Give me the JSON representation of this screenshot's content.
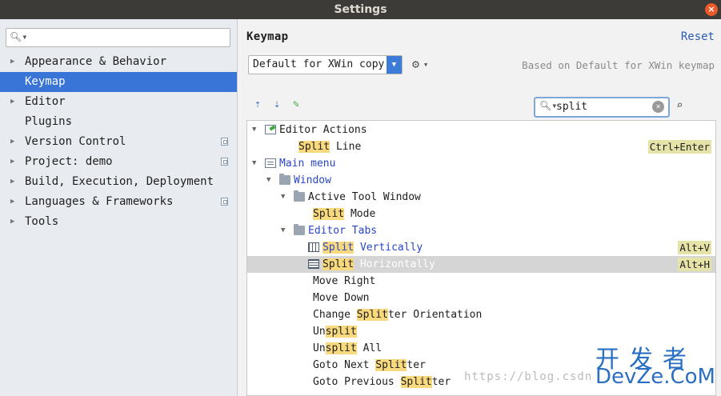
{
  "window": {
    "title": "Settings",
    "close_glyph": "×"
  },
  "sidebar": {
    "search_value": "",
    "items": [
      {
        "label": "Appearance & Behavior",
        "expandable": true,
        "selected": false,
        "project_level": false
      },
      {
        "label": "Keymap",
        "expandable": false,
        "selected": true,
        "project_level": false
      },
      {
        "label": "Editor",
        "expandable": true,
        "selected": false,
        "project_level": false
      },
      {
        "label": "Plugins",
        "expandable": false,
        "selected": false,
        "project_level": false
      },
      {
        "label": "Version Control",
        "expandable": true,
        "selected": false,
        "project_level": true
      },
      {
        "label": "Project: demo",
        "expandable": true,
        "selected": false,
        "project_level": true
      },
      {
        "label": "Build, Execution, Deployment",
        "expandable": true,
        "selected": false,
        "project_level": false
      },
      {
        "label": "Languages & Frameworks",
        "expandable": true,
        "selected": false,
        "project_level": true
      },
      {
        "label": "Tools",
        "expandable": true,
        "selected": false,
        "project_level": false
      }
    ]
  },
  "keymap": {
    "title": "Keymap",
    "reset_label": "Reset",
    "scheme_value": "Default for XWin copy",
    "based_on": "Based on Default for XWin keymap",
    "filter_value": "split",
    "icons": {
      "expand_all": "expand-all-icon",
      "collapse_all": "collapse-all-icon",
      "edit": "pencil-icon",
      "gear": "gear-icon",
      "find_shortcut": "find-by-shortcut-icon"
    }
  },
  "tree": {
    "rows": [
      {
        "depth": 0,
        "twisty": "▼",
        "icon": "edit",
        "parts": [
          [
            "Editor Actions",
            ""
          ]
        ],
        "blue": false,
        "selected": false,
        "shortcut": ""
      },
      {
        "depth": 1,
        "twisty": "",
        "icon": "",
        "parts": [
          [
            "Split",
            "hl"
          ],
          [
            " Line",
            ""
          ]
        ],
        "blue": false,
        "selected": false,
        "shortcut": "Ctrl+Enter"
      },
      {
        "depth": 0,
        "twisty": "▼",
        "icon": "menu",
        "parts": [
          [
            "Main menu",
            ""
          ]
        ],
        "blue": true,
        "selected": false,
        "shortcut": ""
      },
      {
        "depth": 1,
        "twisty": "▼",
        "icon": "folder",
        "parts": [
          [
            "Window",
            ""
          ]
        ],
        "blue": true,
        "selected": false,
        "shortcut": ""
      },
      {
        "depth": 2,
        "twisty": "▼",
        "icon": "folder",
        "parts": [
          [
            "Active Tool Window",
            ""
          ]
        ],
        "blue": false,
        "selected": false,
        "shortcut": ""
      },
      {
        "depth": 3,
        "twisty": "",
        "icon": "",
        "parts": [
          [
            "Split",
            "hl"
          ],
          [
            " Mode",
            ""
          ]
        ],
        "blue": false,
        "selected": false,
        "shortcut": ""
      },
      {
        "depth": 2,
        "twisty": "▼",
        "icon": "folder",
        "parts": [
          [
            "Editor Tabs",
            ""
          ]
        ],
        "blue": true,
        "selected": false,
        "shortcut": ""
      },
      {
        "depth": 3,
        "twisty": "",
        "icon": "vsplit",
        "parts": [
          [
            "Split",
            "hl"
          ],
          [
            " Vertically",
            ""
          ]
        ],
        "blue": true,
        "selected": false,
        "shortcut": "Alt+V"
      },
      {
        "depth": 3,
        "twisty": "",
        "icon": "hsplit",
        "parts": [
          [
            "Split",
            "hl"
          ],
          [
            " Horizontally",
            ""
          ]
        ],
        "blue": false,
        "selected": true,
        "shortcut": "Alt+H"
      },
      {
        "depth": 3,
        "twisty": "",
        "icon": "",
        "parts": [
          [
            "Move Right",
            ""
          ]
        ],
        "blue": false,
        "selected": false,
        "shortcut": ""
      },
      {
        "depth": 3,
        "twisty": "",
        "icon": "",
        "parts": [
          [
            "Move Down",
            ""
          ]
        ],
        "blue": false,
        "selected": false,
        "shortcut": ""
      },
      {
        "depth": 3,
        "twisty": "",
        "icon": "",
        "parts": [
          [
            "Change ",
            ""
          ],
          [
            "Split",
            "hl"
          ],
          [
            "ter Orientation",
            ""
          ]
        ],
        "blue": false,
        "selected": false,
        "shortcut": ""
      },
      {
        "depth": 3,
        "twisty": "",
        "icon": "",
        "parts": [
          [
            "Un",
            ""
          ],
          [
            "split",
            "hl"
          ]
        ],
        "blue": false,
        "selected": false,
        "shortcut": ""
      },
      {
        "depth": 3,
        "twisty": "",
        "icon": "",
        "parts": [
          [
            "Un",
            ""
          ],
          [
            "split",
            "hl"
          ],
          [
            " All",
            ""
          ]
        ],
        "blue": false,
        "selected": false,
        "shortcut": ""
      },
      {
        "depth": 3,
        "twisty": "",
        "icon": "",
        "parts": [
          [
            "Goto Next ",
            ""
          ],
          [
            "Split",
            "hl"
          ],
          [
            "ter",
            ""
          ]
        ],
        "blue": false,
        "selected": false,
        "shortcut": ""
      },
      {
        "depth": 3,
        "twisty": "",
        "icon": "",
        "parts": [
          [
            "Goto Previous ",
            ""
          ],
          [
            "Split",
            "hl"
          ],
          [
            "ter",
            ""
          ]
        ],
        "blue": false,
        "selected": false,
        "shortcut": ""
      }
    ]
  },
  "watermark": {
    "url": "https://blog.csdn",
    "cn": "开发者",
    "en": "DevZe.CoM"
  }
}
